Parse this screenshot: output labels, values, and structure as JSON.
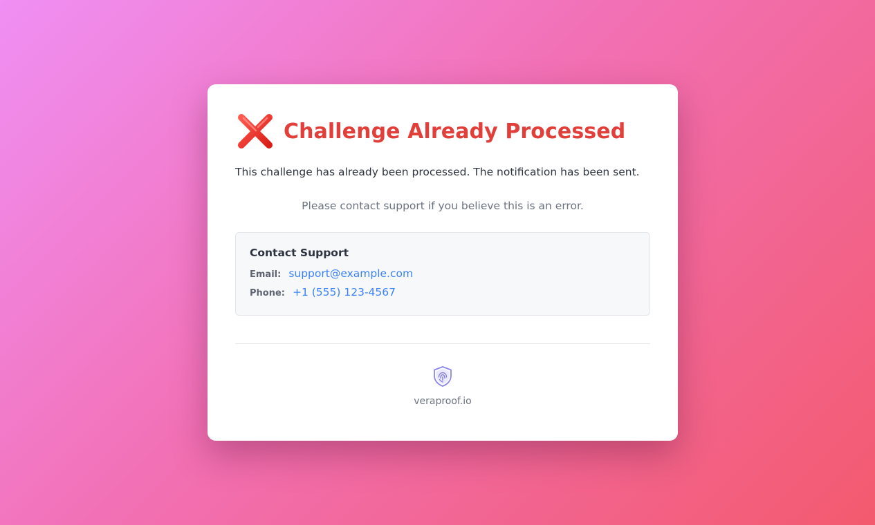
{
  "card": {
    "title": "Challenge Already Processed",
    "title_icon": "cross-mark-icon",
    "message": "This challenge has already been processed. The notification has been sent.",
    "hint": "Please contact support if you believe this is an error."
  },
  "support": {
    "heading": "Contact Support",
    "email_label": "Email:",
    "email_value": "support@example.com",
    "phone_label": "Phone:",
    "phone_value": "+1 (555) 123-4567"
  },
  "footer": {
    "logo_icon": "shield-fingerprint-icon",
    "text": "veraproof.io"
  },
  "colors": {
    "title": "#e23e3a",
    "link": "#3b82f6",
    "background_start": "#f08ff4",
    "background_end": "#f35a6e"
  }
}
